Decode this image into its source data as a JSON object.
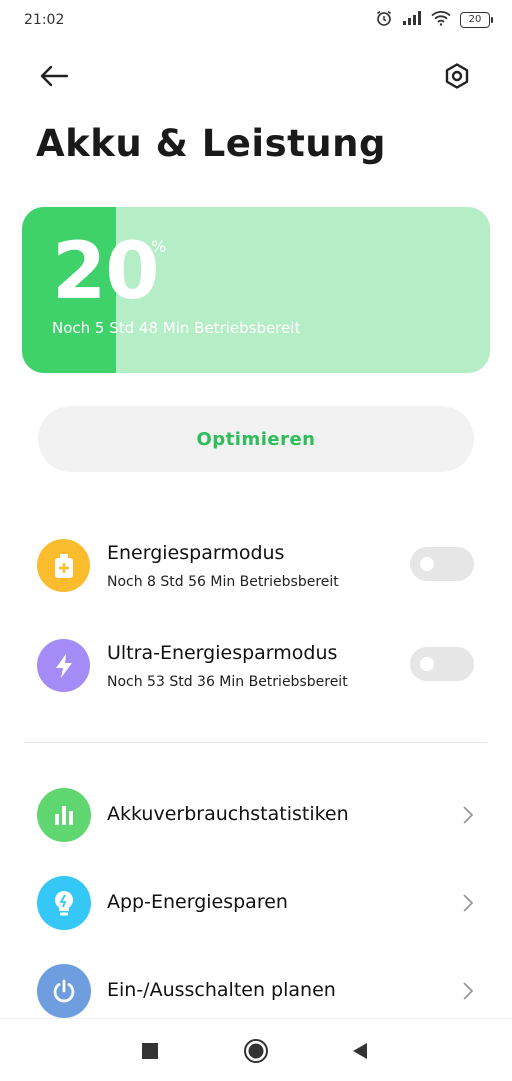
{
  "status_bar": {
    "time": "21:02",
    "battery_level": "20",
    "icons": [
      "alarm-icon",
      "signal-icon",
      "wifi-icon",
      "battery-icon"
    ]
  },
  "header": {
    "back_icon": "arrow-left-icon",
    "settings_icon": "gear-icon",
    "title": "Akku & Leistung"
  },
  "battery": {
    "percent": "20",
    "percent_sign": "%",
    "level_fraction": 0.2,
    "remaining": "Noch 5 Std 48 Min Betriebsbereit",
    "colors": {
      "fill": "#3fd16a",
      "track": "#b5edc6"
    }
  },
  "optimize": {
    "label": "Optimieren"
  },
  "modes": [
    {
      "title": "Energiesparmodus",
      "subtitle": "Noch 8 Std 56 Min Betriebsbereit",
      "icon": "battery-plus-icon",
      "color": "#fbbd2e",
      "enabled": false
    },
    {
      "title": "Ultra-Energiesparmodus",
      "subtitle": "Noch 53 Std 36 Min Betriebsbereit",
      "icon": "lightning-icon",
      "color": "#a48bf5",
      "enabled": false
    }
  ],
  "menu": [
    {
      "label": "Akkuverbrauchstatistiken",
      "icon": "bar-chart-icon",
      "color": "#5fd66f"
    },
    {
      "label": "App-Energiesparen",
      "icon": "lightbulb-icon",
      "color": "#35c7f5"
    },
    {
      "label": "Ein-/Ausschalten planen",
      "icon": "power-icon",
      "color": "#6f9ee0"
    }
  ],
  "navbar": {
    "icons": [
      "recents-square-icon",
      "home-circle-icon",
      "back-triangle-icon"
    ]
  }
}
